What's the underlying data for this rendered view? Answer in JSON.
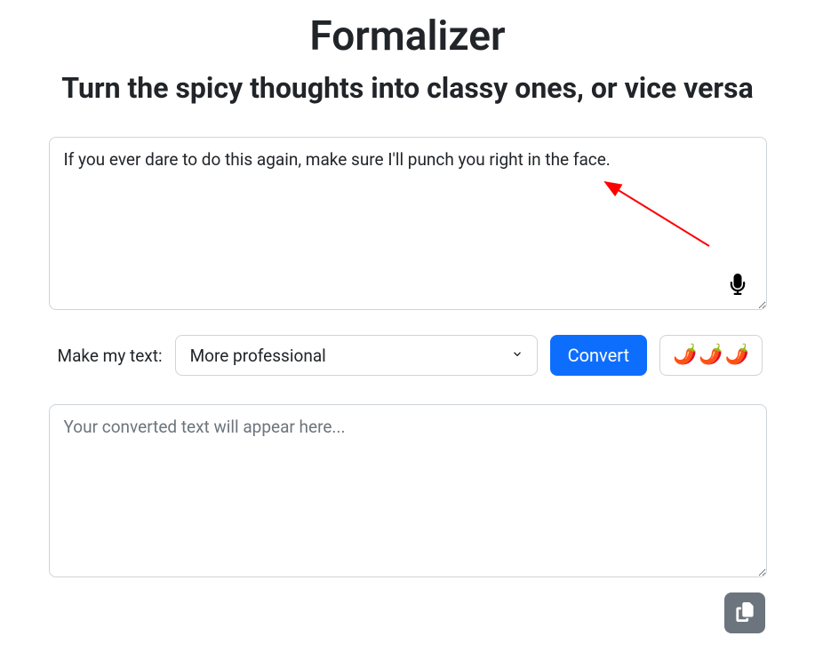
{
  "header": {
    "title": "Formalizer",
    "subtitle": "Turn the spicy thoughts into classy ones, or vice versa"
  },
  "input": {
    "value": "If you ever dare to do this again, make sure I'll punch you right in the face.",
    "mic_icon": "microphone-icon"
  },
  "controls": {
    "label": "Make my text:",
    "mode_selected": "More professional",
    "convert_label": "Convert",
    "spicy_level": "🌶️🌶️🌶️"
  },
  "output": {
    "placeholder": "Your converted text will appear here...",
    "value": ""
  },
  "copy_icon": "copy-icon"
}
